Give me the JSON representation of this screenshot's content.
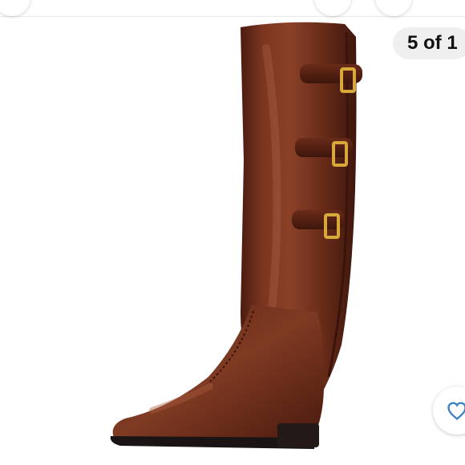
{
  "listing": {
    "image_counter": "5 of 1",
    "photo": {
      "subject": "boot-photo",
      "background_color": "#ffffff",
      "leather_color": "#6e2c19",
      "sole_color": "#1a1414",
      "buckle_color": "#d8a93a"
    },
    "top_controls": [
      "back-button",
      "share-button",
      "more-button"
    ],
    "like_button": {
      "icon": "heart-outline-icon",
      "color": "#3b82c4",
      "liked": false
    }
  }
}
